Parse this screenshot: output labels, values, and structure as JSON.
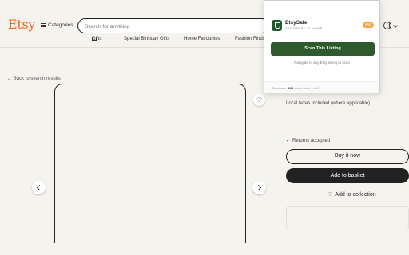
{
  "header": {
    "logo": "Etsy",
    "categories_label": "Categories",
    "search_placeholder": "Search for anything"
  },
  "nav": {
    "items": [
      "Gifts",
      "Special Birthday Gifts",
      "Home Favourites",
      "Fashion Finds"
    ]
  },
  "listing": {
    "back_label": "Back to search results",
    "taxes_note": "Local taxes included (where applicable)",
    "returns_label": "Returns accepted",
    "buy_now_label": "Buy it now",
    "add_basket_label": "Add to basket",
    "add_collection_label": "Add to collection"
  },
  "extension": {
    "title": "EtsySafe",
    "subtitle": "TRADEMARK SCANNER",
    "badge": "PRO",
    "scan_label": "Scan This Listing",
    "hint": "Navigate to any Etsy listing to scan",
    "footer_prefix": "Database:",
    "footer_count": "185",
    "footer_suffix": "trademarks",
    "version": "v2.0"
  },
  "colors": {
    "brand": "#f1641e",
    "scan_button": "#2e5a2d",
    "badge": "#f4a640",
    "primary_button": "#222222"
  }
}
